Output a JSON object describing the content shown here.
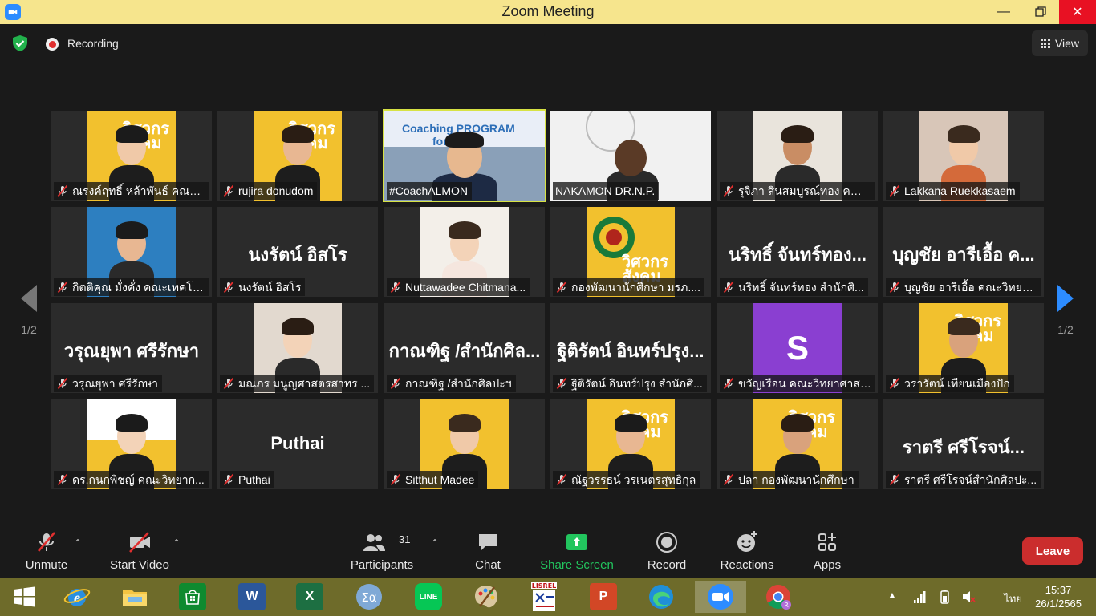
{
  "window": {
    "title": "Zoom Meeting"
  },
  "topbar": {
    "recording_label": "Recording",
    "view_label": "View"
  },
  "pager": {
    "left": "1/2",
    "right": "1/2"
  },
  "tiles": [
    {
      "name": "ณรงค์ฤทธิ์ หล้าพันธ์ คณะวิ...",
      "muted": true
    },
    {
      "name": "rujira donudom",
      "muted": true
    },
    {
      "name": "#CoachALMON",
      "muted": false,
      "banner": "Coaching PROGRAM",
      "banner2": "for ...cer"
    },
    {
      "name": "NAKAMON DR.N.P.",
      "muted": false
    },
    {
      "name": "รุจิภา สินสมบูรณ์ทอง คณะ...",
      "muted": true
    },
    {
      "name": "Lakkana Ruekkasaem",
      "muted": true
    },
    {
      "name": "กิตติคุณ มั่งคั่ง คณะเทคโนโล...",
      "muted": true
    },
    {
      "name": "นงรัตน์ อิสโร",
      "muted": true,
      "big": "นงรัตน์ อิสโร"
    },
    {
      "name": "Nuttawadee Chitmana...",
      "muted": true
    },
    {
      "name": "กองพัฒนานักศึกษา มรภ....",
      "muted": true
    },
    {
      "name": "นริทธิ์ จันทร์ทอง สำนักศิ...",
      "muted": true,
      "big": "นริทธิ์ จันทร์ทอง..."
    },
    {
      "name": "บุญชัย อารีเอื้อ คณะวิทยาศ...",
      "muted": true,
      "big": "บุญชัย อารีเอื้อ ค..."
    },
    {
      "name": "วรุณยุพา ศรีรักษา",
      "muted": true,
      "big": "วรุณยุพา ศรีรักษา"
    },
    {
      "name": "มณภร มนูญศาสตรสาทร ...",
      "muted": true
    },
    {
      "name": "กาณฑิฐ /สำนักศิลปะฯ",
      "muted": true,
      "big": "กาณฑิฐ /สำนักศิล..."
    },
    {
      "name": "ฐิติรัตน์ อินทร์ปรุง สำนักศิ...",
      "muted": true,
      "big": "ฐิติรัตน์ อินทร์ปรุง..."
    },
    {
      "name": "ขวัญเรือน คณะวิทยาศาสต...",
      "muted": true,
      "avatar": "S"
    },
    {
      "name": "วรารัตน์ เทียนเมืองปัก",
      "muted": true
    },
    {
      "name": "ดร.กนกพิชญ์ คณะวิทยาก...",
      "muted": true
    },
    {
      "name": "Puthai",
      "muted": true,
      "big": "Puthai"
    },
    {
      "name": "Sitthut Madee",
      "muted": true
    },
    {
      "name": "ณัฐวรรธน์ วรเนตรสุทธิกุล",
      "muted": true
    },
    {
      "name": "ปลา กองพัฒนานักศึกษา",
      "muted": true
    },
    {
      "name": "ราตรี ศรีโรจน์สำนักศิลปะ...",
      "muted": true,
      "big": "ราตรี ศรีโรจน์..."
    }
  ],
  "poster_brand": {
    "l1": "วิศวกร",
    "l2": "สังคม"
  },
  "toolbar": {
    "unmute": "Unmute",
    "start_video": "Start Video",
    "participants": "Participants",
    "participants_count": "31",
    "chat": "Chat",
    "share_screen": "Share Screen",
    "record": "Record",
    "reactions": "Reactions",
    "apps": "Apps",
    "leave": "Leave"
  },
  "taskbar": {
    "lang": "ไทย",
    "time": "15:37",
    "date": "26/1/2565"
  },
  "colors": {
    "titlebar": "#f6e58d",
    "taskbar": "#6e6b2a",
    "accent_share": "#22c55e",
    "leave": "#cb2d2d",
    "active_speaker": "#d7e244"
  }
}
